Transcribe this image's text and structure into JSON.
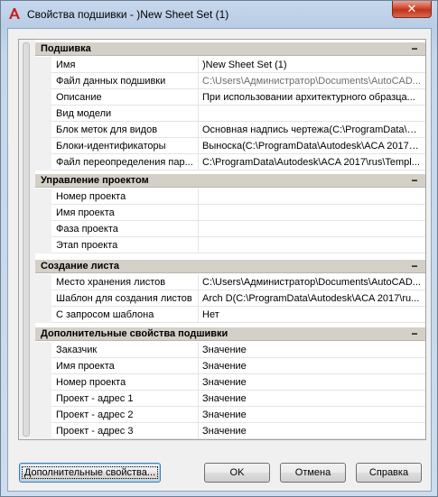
{
  "window": {
    "title": "Свойства подшивки - )New Sheet Set (1)",
    "close_symbol": "✕",
    "app_icon": "autocad-a-icon"
  },
  "categories": [
    {
      "label": "Подшивка",
      "toggle": "−",
      "rows": [
        {
          "name": "Имя",
          "value": ")New Sheet Set (1)"
        },
        {
          "name": "Файл данных подшивки",
          "value": "C:\\Users\\Администратор\\Documents\\AutoCAD..."
        },
        {
          "name": "Описание",
          "value": "При использовании архитектурного образца..."
        },
        {
          "name": "Вид модели",
          "value": ""
        },
        {
          "name": "Блок меток для видов",
          "value": "Основная надпись чертежа(C:\\ProgramData\\A..."
        },
        {
          "name": "Блоки-идентификаторы",
          "value": "Выноска(C:\\ProgramData\\Autodesk\\ACA 2017\\ru..."
        },
        {
          "name": "Файл переопределения пар...",
          "value": "C:\\ProgramData\\Autodesk\\ACA 2017\\rus\\Templ..."
        }
      ]
    },
    {
      "label": "Управление проектом",
      "toggle": "−",
      "rows": [
        {
          "name": "Номер проекта",
          "value": ""
        },
        {
          "name": "Имя проекта",
          "value": ""
        },
        {
          "name": "Фаза проекта",
          "value": ""
        },
        {
          "name": "Этап проекта",
          "value": ""
        }
      ]
    },
    {
      "label": "Создание листа",
      "toggle": "−",
      "rows": [
        {
          "name": "Место хранения листов",
          "value": "C:\\Users\\Администратор\\Documents\\AutoCAD..."
        },
        {
          "name": "Шаблон для создания листов",
          "value": "Arch D(C:\\ProgramData\\Autodesk\\ACA 2017\\ru..."
        },
        {
          "name": "С запросом шаблона",
          "value": "Нет"
        }
      ]
    },
    {
      "label": "Дополнительные свойства подшивки",
      "toggle": "−",
      "rows": [
        {
          "name": "Заказчик",
          "value": "Значение"
        },
        {
          "name": "Имя проекта",
          "value": "Значение"
        },
        {
          "name": "Номер проекта",
          "value": "Значение"
        },
        {
          "name": "Проект - адрес 1",
          "value": "Значение"
        },
        {
          "name": "Проект - адрес 2",
          "value": "Значение"
        },
        {
          "name": "Проект - адрес 3",
          "value": "Значение"
        }
      ]
    }
  ],
  "buttons": {
    "custom_properties": "Дополнительные свойства...",
    "ok": "OK",
    "cancel": "Отмена",
    "help": "Справка"
  }
}
